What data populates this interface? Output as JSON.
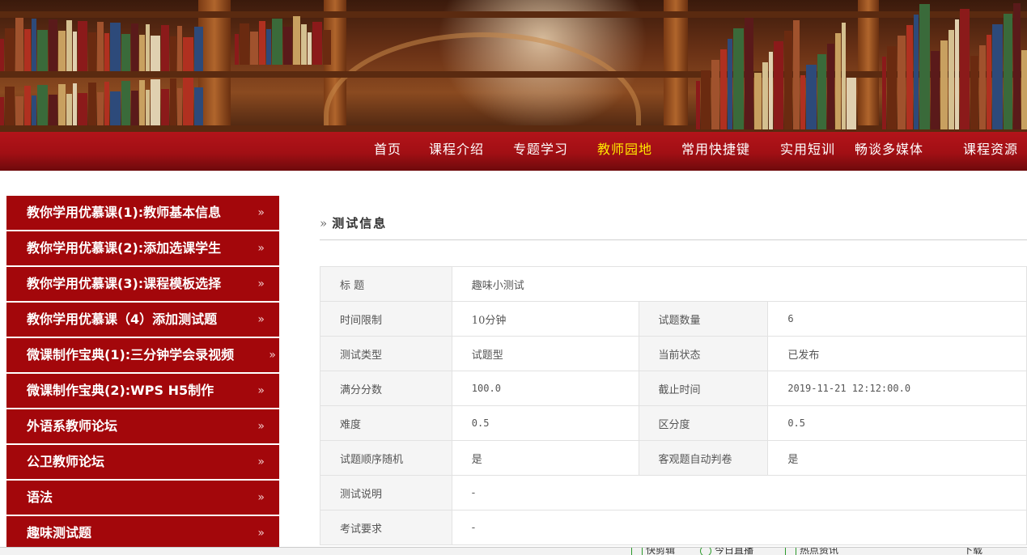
{
  "nav": {
    "items": [
      {
        "label": "首页"
      },
      {
        "label": "课程介绍"
      },
      {
        "label": "专题学习"
      },
      {
        "label": "教师园地",
        "active": true
      },
      {
        "label": "常用快捷键"
      },
      {
        "label": "实用短训"
      },
      {
        "label": "畅谈多媒体"
      },
      {
        "label": "课程资源"
      }
    ],
    "active_color": "#ffea00"
  },
  "sidebar": {
    "arrow": "»",
    "items": [
      {
        "label": "教你学用优慕课(1):教师基本信息"
      },
      {
        "label": "教你学用优慕课(2):添加选课学生"
      },
      {
        "label": "教你学用优慕课(3):课程模板选择"
      },
      {
        "label": "教你学用优慕课（4）添加测试题"
      },
      {
        "label": "微课制作宝典(1):三分钟学会录视频"
      },
      {
        "label": "微课制作宝典(2):WPS H5制作"
      },
      {
        "label": "外语系教师论坛"
      },
      {
        "label": "公卫教师论坛"
      },
      {
        "label": "语法"
      },
      {
        "label": "趣味测试题"
      }
    ],
    "bg_color": "#a3070b"
  },
  "main": {
    "section_marker": "»",
    "section_title": "测试信息",
    "info": {
      "title_label": "标 题",
      "title_value": "趣味小测试",
      "time_limit_label": "时间限制",
      "time_limit_value": "10分钟",
      "question_count_label": "试题数量",
      "question_count_value": "6",
      "test_type_label": "测试类型",
      "test_type_value": "试题型",
      "status_label": "当前状态",
      "status_value": "已发布",
      "full_score_label": "满分分数",
      "full_score_value": "100.0",
      "deadline_label": "截止时间",
      "deadline_value": "2019-11-21 12:12:00.0",
      "difficulty_label": "难度",
      "difficulty_value": "0.5",
      "discrimination_label": "区分度",
      "discrimination_value": "0.5",
      "random_order_label": "试题顺序随机",
      "random_order_value": "是",
      "auto_grade_label": "客观题自动判卷",
      "auto_grade_value": "是",
      "description_label": "测试说明",
      "description_value": "-",
      "requirement_label": "考试要求",
      "requirement_value": "-"
    }
  },
  "statusbar": {
    "item1": "快剪辑",
    "item2": "今日直播",
    "item3": "热点资讯",
    "item4": "下载"
  },
  "colors": {
    "nav_red": "#a10f14",
    "sidebar_red": "#a3070b"
  }
}
